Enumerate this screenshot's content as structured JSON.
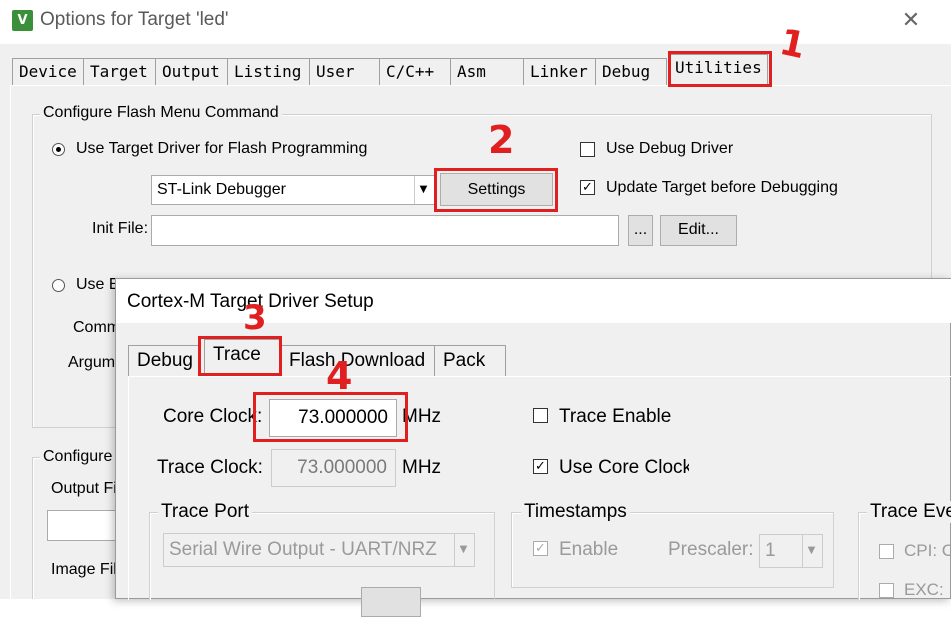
{
  "options_window": {
    "title": "Options for Target 'led'",
    "app_icon": "keil-uvision-icon",
    "tabs": [
      "Device",
      "Target",
      "Output",
      "Listing",
      "User",
      "C/C++",
      "Asm",
      "Linker",
      "Debug",
      "Utilities"
    ],
    "active_tab": "Utilities",
    "flash_group": {
      "title": "Configure Flash Menu Command",
      "use_target_driver_label": "Use Target Driver for Flash Programming",
      "driver_value": "ST-Link Debugger",
      "settings_label": "Settings",
      "init_file_label": "Init File:",
      "init_file_value": "",
      "browse_label": "...",
      "edit_label": "Edit...",
      "use_debug_driver_label": "Use Debug Driver",
      "update_target_label": "Update Target before Debugging",
      "use_external_label_partial": "Use E",
      "command_label_partial": "Comm",
      "arguments_label_partial": "Argum"
    },
    "image_group": {
      "title_partial": "Configure",
      "output_file_partial": "Output Fi",
      "image_file_partial": "Image Fil"
    }
  },
  "cortex_dialog": {
    "title": "Cortex-M Target Driver Setup",
    "tabs": [
      "Debug",
      "Trace",
      "Flash Download",
      "Pack"
    ],
    "active_tab": "Trace",
    "core_clock_label": "Core Clock:",
    "core_clock_value": "73.000000",
    "core_clock_unit": "MHz",
    "trace_clock_label": "Trace Clock:",
    "trace_clock_value": "73.000000",
    "trace_clock_unit": "MHz",
    "trace_enable_label": "Trace Enable",
    "use_core_clock_label": "Use Core Clock",
    "trace_port_title": "Trace Port",
    "trace_port_value": "Serial Wire Output - UART/NRZ",
    "timestamps_title": "Timestamps",
    "timestamps_enable_label": "Enable",
    "prescaler_label": "Prescaler:",
    "prescaler_value": "1",
    "trace_events_title_partial": "Trace Eve",
    "cpi_label_partial": "CPI: C",
    "exc_label_partial": "EXC: "
  },
  "annotations": [
    "1",
    "2",
    "3",
    "4"
  ],
  "colors": {
    "annotation_red": "#e02020",
    "window_bg": "#f0f0f0"
  }
}
